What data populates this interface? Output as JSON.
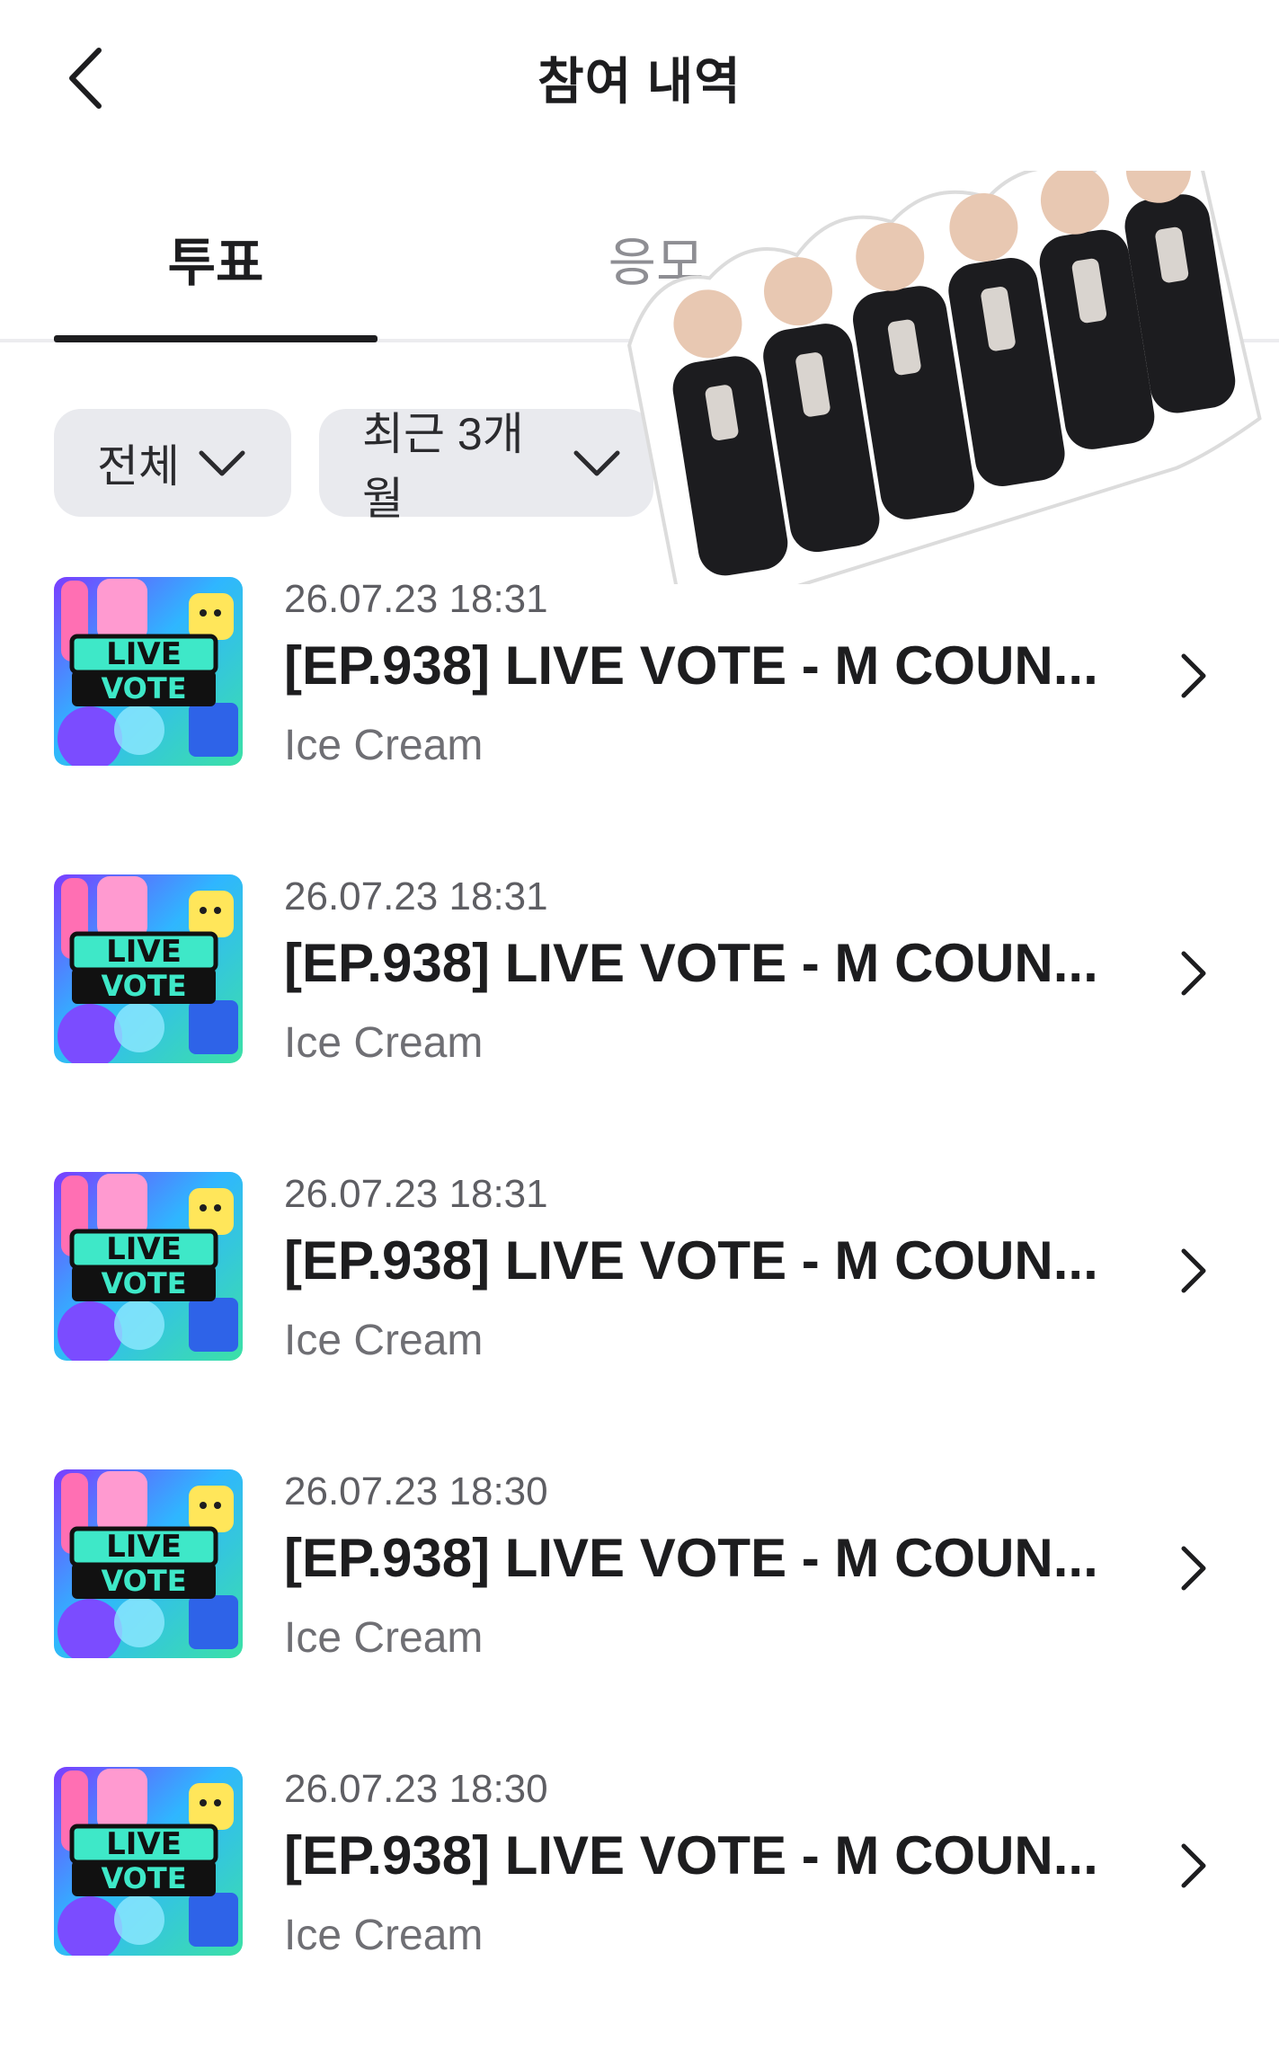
{
  "header": {
    "title": "참여 내역"
  },
  "tabs": [
    {
      "label": "투표",
      "active": true
    },
    {
      "label": "응모",
      "active": false
    }
  ],
  "filters": [
    {
      "label": "전체"
    },
    {
      "label": "최근 3개월"
    }
  ],
  "thumbnail": {
    "line1": "LIVE",
    "line2": "VOTE"
  },
  "list": [
    {
      "date": "26.07.23 18:31",
      "title": "[EP.938] LIVE VOTE - M COUN...",
      "subtitle": "Ice Cream"
    },
    {
      "date": "26.07.23 18:31",
      "title": "[EP.938] LIVE VOTE - M COUN...",
      "subtitle": "Ice Cream"
    },
    {
      "date": "26.07.23 18:31",
      "title": "[EP.938] LIVE VOTE - M COUN...",
      "subtitle": "Ice Cream"
    },
    {
      "date": "26.07.23 18:30",
      "title": "[EP.938] LIVE VOTE - M COUN...",
      "subtitle": "Ice Cream"
    },
    {
      "date": "26.07.23 18:30",
      "title": "[EP.938] LIVE VOTE - M COUN...",
      "subtitle": "Ice Cream"
    }
  ],
  "colors": {
    "active_tab": "#1d1d1f",
    "inactive_tab": "#8e8e93",
    "filter_bg": "#e9eaee"
  },
  "icons": [
    "back-arrow-icon",
    "chevron-down-icon",
    "chevron-right-icon"
  ]
}
